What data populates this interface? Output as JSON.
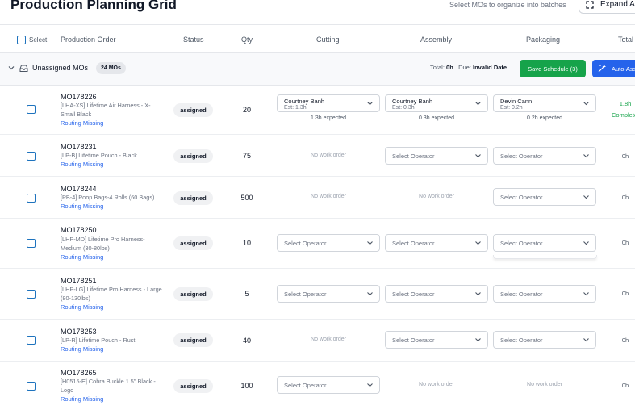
{
  "header": {
    "title": "Production Planning Grid",
    "hint": "Select MOs to organize into batches",
    "expand_label": "Expand All"
  },
  "columns": {
    "select": "Select",
    "production_order": "Production Order",
    "status": "Status",
    "qty": "Qty",
    "cutting": "Cutting",
    "assembly": "Assembly",
    "packaging": "Packaging",
    "total": "Total"
  },
  "group": {
    "title": "Unassigned MOs",
    "count": "24 MOs",
    "total_label": "Total:",
    "total_value": "0h",
    "due_label": "Due:",
    "due_value": "Invalid Date",
    "save_label": "Save Schedule (3)",
    "auto_label": "Auto-Assign"
  },
  "placeholders": {
    "select_operator": "Select Operator",
    "no_work_order": "No work order"
  },
  "rows": [
    {
      "id": "MO178226",
      "desc": "[LHA-XS] Lifetime Air Harness - X-Small Black",
      "routing": "Routing Missing",
      "status": "assigned",
      "qty": "20",
      "cutting": {
        "operator": "Courtney Banh",
        "est": "Est: 1.3h",
        "expected": "1.3h expected"
      },
      "assembly": {
        "operator": "Courtney Banh",
        "est": "Est: 0.3h",
        "expected": "0.3h expected"
      },
      "packaging": {
        "operator": "Devin Cann",
        "est": "Est: 0.2h",
        "expected": "0.2h expected"
      },
      "total": "1.8h",
      "total_status": "Complete"
    },
    {
      "id": "MO178231",
      "desc": "[LP-B] Lifetime Pouch - Black",
      "routing": "Routing Missing",
      "status": "assigned",
      "qty": "75",
      "total": "0h"
    },
    {
      "id": "MO178244",
      "desc": "[PB-4] Poop Bags-4 Rolls (60 Bags)",
      "routing": "Routing Missing",
      "status": "assigned",
      "qty": "500",
      "total": "0h"
    },
    {
      "id": "MO178250",
      "desc": "[LHP-MD] Lifetime Pro Harness- Medium (30-80lbs)",
      "routing": "Routing Missing",
      "status": "assigned",
      "qty": "10",
      "total": "0h"
    },
    {
      "id": "MO178251",
      "desc": "[LHP-LG] Lifetime Pro Harness - Large (80-130lbs)",
      "routing": "Routing Missing",
      "status": "assigned",
      "qty": "5",
      "total": "0h"
    },
    {
      "id": "MO178253",
      "desc": "[LP-R] Lifetime Pouch - Rust",
      "routing": "Routing Missing",
      "status": "assigned",
      "qty": "40",
      "total": "0h"
    },
    {
      "id": "MO178265",
      "desc": "[H0515-E] Cobra Buckle 1.5\" Black - Logo",
      "routing": "Routing Missing",
      "status": "assigned",
      "qty": "100",
      "total": "0h"
    }
  ],
  "colors": {
    "accent_blue": "#2563eb",
    "success_green": "#16a34a"
  }
}
